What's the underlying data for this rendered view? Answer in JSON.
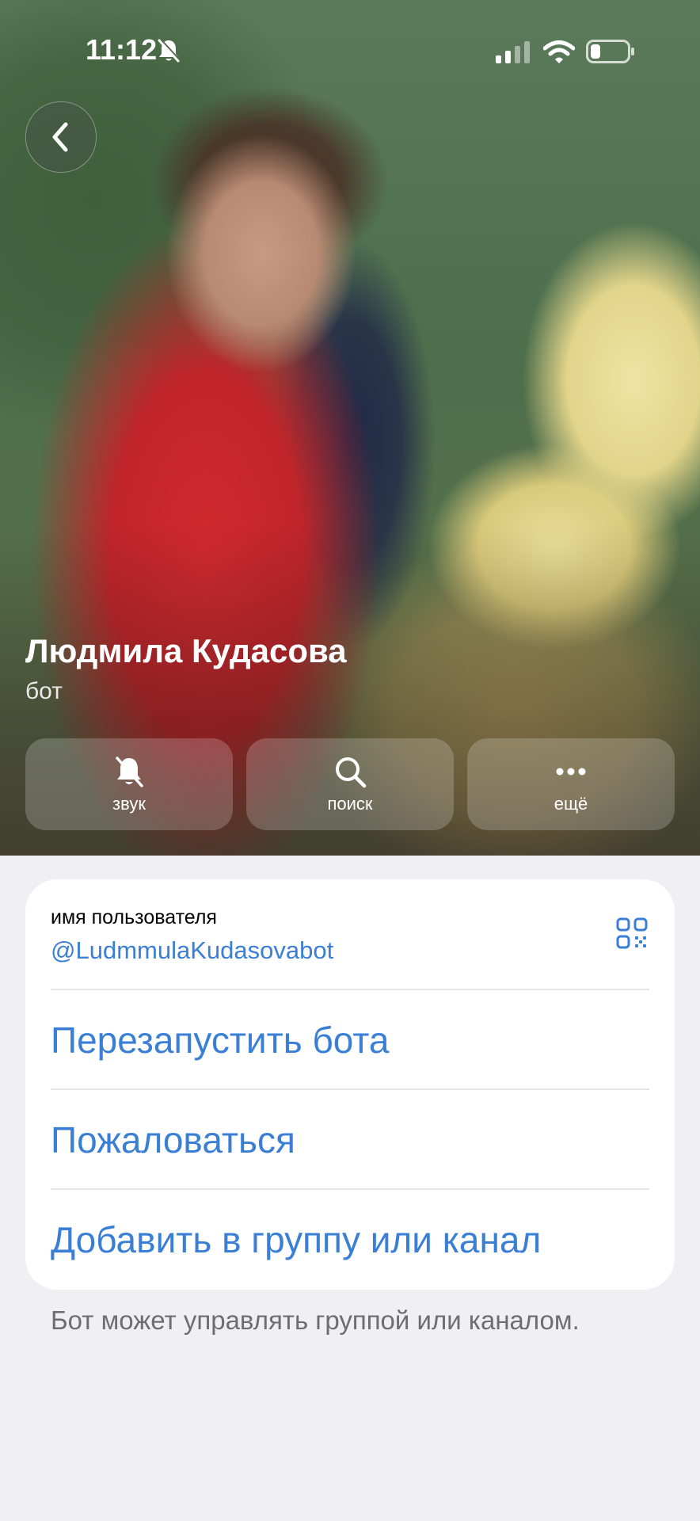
{
  "status_bar": {
    "time": "11:12",
    "icons": [
      "bell-off-icon",
      "cellular-signal-icon",
      "wifi-icon",
      "battery-icon"
    ]
  },
  "header": {
    "back_icon": "chevron-left-icon"
  },
  "profile": {
    "name": "Людмила Кудасова",
    "subtitle": "бот"
  },
  "actions": [
    {
      "label": "звук",
      "icon": "bell-off-icon"
    },
    {
      "label": "поиск",
      "icon": "search-icon"
    },
    {
      "label": "ещё",
      "icon": "more-icon"
    }
  ],
  "info_card": {
    "username_title": "имя пользователя",
    "username": "@LudmmulaKudasovabot",
    "qr_icon": "qr-code-icon",
    "links": [
      "Перезапустить бота",
      "Пожаловаться",
      "Добавить в группу или канал"
    ]
  },
  "footer_note": "Бот может управлять группой или каналом.",
  "colors": {
    "accent": "#3a7fd5",
    "background": "#efeff4",
    "card": "#ffffff",
    "note_text": "#6d6d72"
  }
}
